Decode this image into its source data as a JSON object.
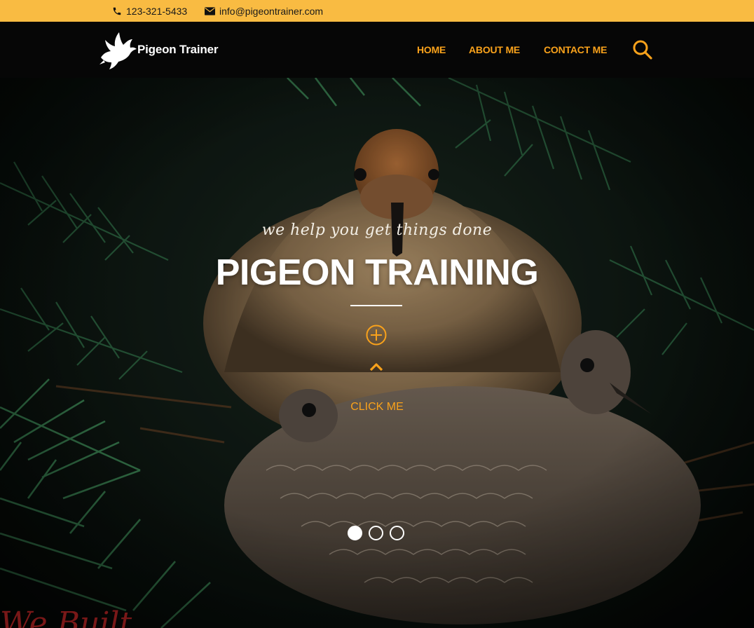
{
  "topbar": {
    "phone": "123-321-5433",
    "phone_icon": "phone-icon",
    "email": "info@pigeontrainer.com",
    "email_icon": "envelope-icon",
    "background": "#f9bb42"
  },
  "nav": {
    "brand": "Pigeon Trainer",
    "logo_icon": "dove-icon",
    "items": [
      {
        "label": "HOME"
      },
      {
        "label": "ABOUT ME"
      },
      {
        "label": "CONTACT ME"
      }
    ],
    "search_icon": "search-icon",
    "accent": "#f9a21b",
    "background": "#060606"
  },
  "hero": {
    "tagline": "we help you get things done",
    "title": "PIGEON TRAINING",
    "plus_icon": "plus-circle-icon",
    "chevron_icon": "chevron-up-icon",
    "cta": "CLICK ME",
    "slides": {
      "count": 3,
      "active": 1
    },
    "script_text": "We Built"
  }
}
